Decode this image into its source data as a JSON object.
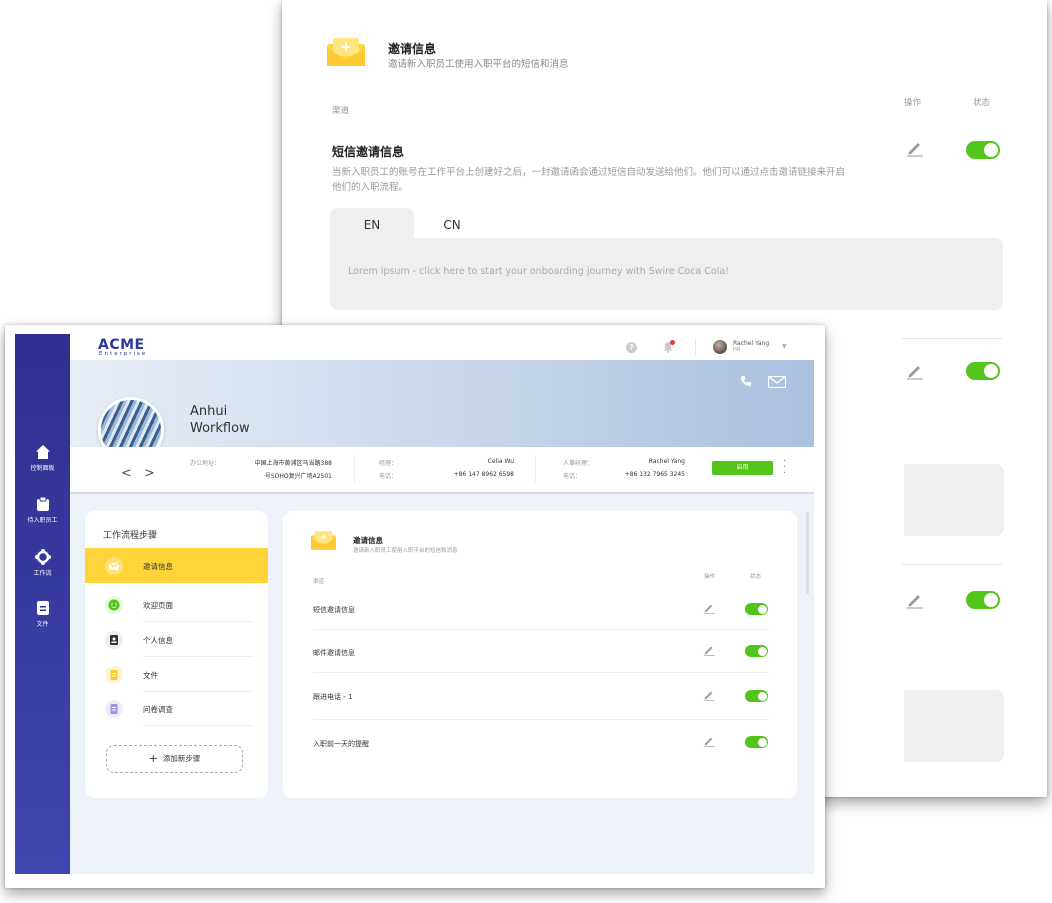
{
  "back_card": {
    "title": "邀请信息",
    "subtitle": "邀请新入职员工使用入职平台的短信和消息",
    "col_channel": "渠道",
    "col_operation": "操作",
    "col_status": "状态",
    "sms_title": "短信邀请信息",
    "sms_description": "当新入职员工的账号在工作平台上创建好之后，一封邀请函会通过短信自动发送给他们。他们可以通过点击邀请链接来开启他们的入职流程。",
    "tabs": [
      "EN",
      "CN"
    ],
    "message_text": "Lorem ipsum - click here to start your onboarding journey with Swire Coca Cola!"
  },
  "app": {
    "logo": "ACME",
    "logo_sub": "Enterprise",
    "help_icon": "?",
    "user": {
      "name": "Rachel Yang",
      "role": "HR"
    },
    "sidebar": [
      {
        "icon": "home-icon",
        "label": "控制面板"
      },
      {
        "icon": "clipboard-icon",
        "label": "待入职员工"
      },
      {
        "icon": "workflow-icon",
        "label": "工作流"
      },
      {
        "icon": "document-icon",
        "label": "文件"
      }
    ],
    "workspace": {
      "name_line1": "Anhui",
      "name_line2": "Workflow",
      "arrows": "< >"
    },
    "info": {
      "address_label": "办公地址：",
      "address_line1": "中国上海市黄浦区马当路388",
      "address_line2": "号SOHO复兴广场A2501",
      "manager_label": "经理：",
      "manager_name": "Celia Wu",
      "manager_phone_label": "电话：",
      "manager_phone": "+86 147 8962 6598",
      "hr_label": "人事经理：",
      "hr_name": "Rachel Yang",
      "hr_phone_label": "电话：",
      "hr_phone": "+86 132 7965 3245",
      "enable_button": "启用"
    },
    "steps": {
      "title": "工作流程步骤",
      "items": [
        {
          "label": "邀请信息",
          "icon": "envelope-icon",
          "active": true
        },
        {
          "label": "欢迎页面",
          "icon": "smile-icon",
          "active": false
        },
        {
          "label": "个人信息",
          "icon": "person-card-icon",
          "active": false
        },
        {
          "label": "文件",
          "icon": "file-icon",
          "active": false
        },
        {
          "label": "问卷调查",
          "icon": "survey-icon",
          "active": false
        }
      ],
      "add_button": "添加新步骤"
    },
    "panel": {
      "title": "邀请信息",
      "subtitle": "邀请新入职员工使用入职平台的短信和消息",
      "col_channel": "渠道",
      "col_operation": "操作",
      "col_status": "状态",
      "rows": [
        {
          "label": "短信邀请信息",
          "enabled": true
        },
        {
          "label": "邮件邀请信息",
          "enabled": true
        },
        {
          "label": "跟进电话 - 1",
          "enabled": true
        },
        {
          "label": "入职前一天的提醒",
          "enabled": true
        }
      ]
    }
  },
  "colors": {
    "accent_yellow": "#ffd43b",
    "toggle_green": "#52c41a",
    "sidebar_blue": "#2f2f8f",
    "logo_blue": "#2a3a9c"
  }
}
